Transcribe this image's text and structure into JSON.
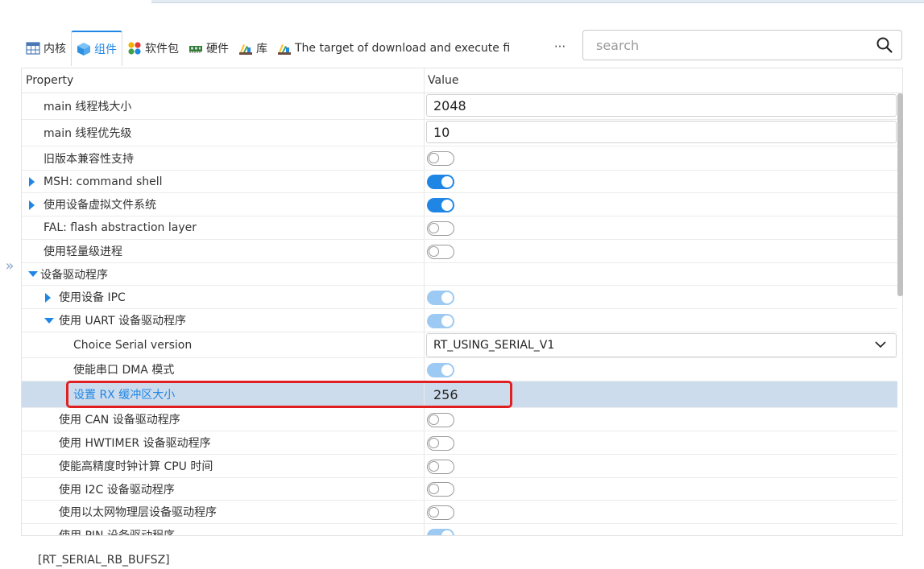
{
  "tabs": [
    {
      "label": "内核",
      "icon": "table-grid-icon",
      "active": false
    },
    {
      "label": "组件",
      "icon": "cube-icon",
      "active": true
    },
    {
      "label": "软件包",
      "icon": "colorful-dots-icon",
      "active": false
    },
    {
      "label": "硬件",
      "icon": "circuit-board-icon",
      "active": false
    },
    {
      "label": "库",
      "icon": "books-icon",
      "active": false
    },
    {
      "label": "The target of download and execute fi",
      "icon": "books-icon",
      "active": false
    }
  ],
  "more_label": "···",
  "search": {
    "placeholder": "search",
    "value": ""
  },
  "grid": {
    "header": {
      "property": "Property",
      "value": "Value"
    },
    "rows": [
      {
        "label": "main 线程栈大小",
        "value_type": "text",
        "value": "2048"
      },
      {
        "label": "main 线程优先级",
        "value_type": "text",
        "value": "10"
      },
      {
        "label": "旧版本兼容性支持",
        "value_type": "toggle",
        "state": "off"
      },
      {
        "label": "MSH: command shell",
        "value_type": "toggle",
        "state": "on",
        "expander": "collapsed"
      },
      {
        "label": "使用设备虚拟文件系统",
        "value_type": "toggle",
        "state": "on",
        "expander": "collapsed"
      },
      {
        "label": "FAL: flash abstraction layer",
        "value_type": "toggle",
        "state": "off"
      },
      {
        "label": "使用轻量级进程",
        "value_type": "toggle",
        "state": "off"
      },
      {
        "label": "设备驱动程序",
        "value_type": "none",
        "expander": "expanded"
      },
      {
        "label": "使用设备 IPC",
        "value_type": "toggle",
        "state": "disabled-on",
        "expander": "collapsed"
      },
      {
        "label": "使用 UART 设备驱动程序",
        "value_type": "toggle",
        "state": "disabled-on",
        "expander": "expanded"
      },
      {
        "label": "Choice Serial version",
        "value_type": "select",
        "value": "RT_USING_SERIAL_V1"
      },
      {
        "label": "使能串口 DMA 模式",
        "value_type": "toggle",
        "state": "disabled-on"
      },
      {
        "label": "设置 RX 缓冲区大小",
        "value_type": "plain",
        "value": "256",
        "selected": true
      },
      {
        "label": "使用 CAN 设备驱动程序",
        "value_type": "toggle",
        "state": "off"
      },
      {
        "label": "使用 HWTIMER 设备驱动程序",
        "value_type": "toggle",
        "state": "off"
      },
      {
        "label": "使能高精度时钟计算 CPU 时间",
        "value_type": "toggle",
        "state": "off"
      },
      {
        "label": "使用 I2C 设备驱动程序",
        "value_type": "toggle",
        "state": "off"
      },
      {
        "label": "使用以太网物理层设备驱动程序",
        "value_type": "toggle",
        "state": "off"
      },
      {
        "label": "使用 PIN 设备驱动程序",
        "value_type": "toggle",
        "state": "disabled-on"
      }
    ]
  },
  "footer": {
    "macro": "[RT_SERIAL_RB_BUFSZ]"
  },
  "colors": {
    "accent": "#1f86e6",
    "selected_row": "#cddcec",
    "highlight_box": "#e02020"
  }
}
